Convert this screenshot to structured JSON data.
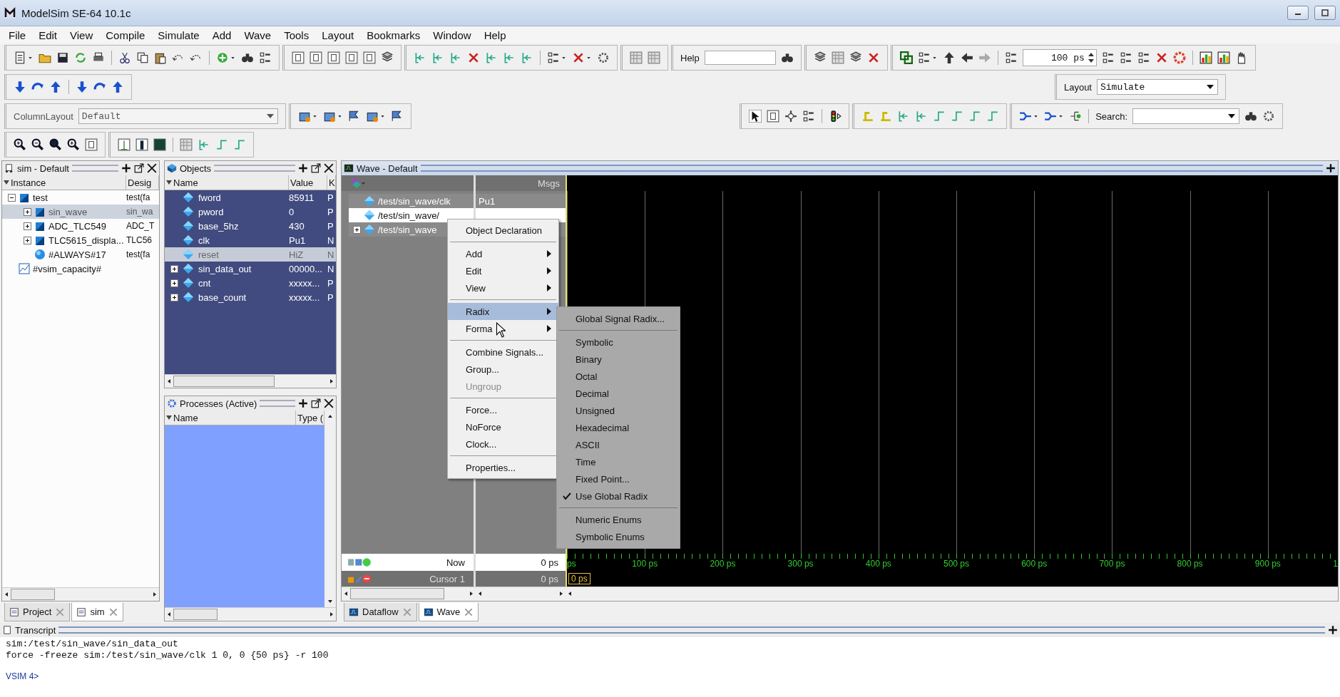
{
  "window": {
    "title": "ModelSim SE-64 10.1c"
  },
  "menu": [
    "File",
    "Edit",
    "View",
    "Compile",
    "Simulate",
    "Add",
    "Wave",
    "Tools",
    "Layout",
    "Bookmarks",
    "Window",
    "Help"
  ],
  "toolbar": {
    "help_label": "Help",
    "run_length": "100 ps",
    "layout_label": "Layout",
    "layout_value": "Simulate",
    "column_layout_label": "ColumnLayout",
    "column_layout_value": "Default",
    "search_label": "Search:"
  },
  "sim_panel": {
    "title": "sim - Default",
    "columns": [
      "Instance",
      "Desig"
    ],
    "tree": [
      {
        "kind": "instance",
        "name": "test",
        "design": "test(fa",
        "expanded": true,
        "selected": false,
        "children": [
          {
            "kind": "instance",
            "name": "sin_wave",
            "design": "sin_wa",
            "expanded": false,
            "selected": true
          },
          {
            "kind": "instance",
            "name": "ADC_TLC549",
            "design": "ADC_T",
            "expanded": false,
            "selected": false
          },
          {
            "kind": "instance",
            "name": "TLC5615_displa...",
            "design": "TLC56",
            "expanded": false,
            "selected": false
          },
          {
            "kind": "process",
            "name": "#ALWAYS#17",
            "design": "test(fa",
            "selected": false
          }
        ]
      },
      {
        "kind": "capacity",
        "name": "#vsim_capacity#",
        "selected": false
      }
    ]
  },
  "left_tabs": [
    {
      "label": "Project",
      "selected": false
    },
    {
      "label": "sim",
      "selected": true
    }
  ],
  "objects_panel": {
    "title": "Objects",
    "columns": [
      "Name",
      "Value",
      "K"
    ],
    "rows": [
      {
        "name": "fword",
        "value": "85911",
        "column_3": "P",
        "selected": false
      },
      {
        "name": "pword",
        "value": "0",
        "column_3": "P",
        "selected": false
      },
      {
        "name": "base_5hz",
        "value": "430",
        "column_3": "P",
        "selected": false
      },
      {
        "name": "clk",
        "value": "Pu1",
        "column_3": "N",
        "selected": false
      },
      {
        "name": "reset",
        "value": "HiZ",
        "column_3": "N",
        "selected": true
      },
      {
        "name": "sin_data_out",
        "value": "00000...",
        "column_3": "N",
        "expanded": false,
        "selected": false
      },
      {
        "name": "cnt",
        "value": "xxxxx...",
        "column_3": "P",
        "expanded": false,
        "selected": false
      },
      {
        "name": "base_count",
        "value": "xxxxx...",
        "column_3": "P",
        "expanded": false,
        "selected": false
      }
    ]
  },
  "processes_panel": {
    "title": "Processes (Active)",
    "columns": [
      "Name",
      "Type ("
    ]
  },
  "wave": {
    "title": "Wave - Default",
    "msgs_label": "Msgs",
    "signals": [
      {
        "path": "/test/sin_wave/clk",
        "value": "Pu1",
        "selected": false
      },
      {
        "path": "/test/sin_wave/",
        "selected": true
      },
      {
        "path": "/test/sin_wave",
        "expanded": false,
        "selected": false
      }
    ],
    "now": {
      "label": "Now",
      "value": "0 ps"
    },
    "cursor": {
      "label": "Cursor 1",
      "value": "0 ps",
      "marker": "0 ps"
    },
    "time_labels": [
      "ps",
      "100 ps",
      "200 ps",
      "300 ps",
      "400 ps",
      "500 ps",
      "600 ps",
      "700 ps",
      "800 ps",
      "900 ps",
      "1"
    ]
  },
  "context_menu": {
    "items": [
      {
        "kind": "item",
        "label": "Object Declaration",
        "disabled": false,
        "selected": false
      },
      {
        "kind": "separator"
      },
      {
        "kind": "submenu",
        "label": "Add",
        "disabled": false,
        "selected": false
      },
      {
        "kind": "submenu",
        "label": "Edit",
        "disabled": false,
        "selected": false
      },
      {
        "kind": "submenu",
        "label": "View",
        "disabled": false,
        "selected": false
      },
      {
        "kind": "separator"
      },
      {
        "kind": "submenu",
        "label": "Radix",
        "disabled": false,
        "selected": true
      },
      {
        "kind": "submenu",
        "label": "Forma",
        "disabled": false,
        "selected": false
      },
      {
        "kind": "separator"
      },
      {
        "kind": "item",
        "label": "Combine Signals...",
        "disabled": false,
        "selected": false
      },
      {
        "kind": "item",
        "label": "Group...",
        "disabled": false,
        "selected": false
      },
      {
        "kind": "item",
        "label": "Ungroup",
        "disabled": true,
        "selected": false
      },
      {
        "kind": "separator"
      },
      {
        "kind": "item",
        "label": "Force...",
        "disabled": false,
        "selected": false
      },
      {
        "kind": "item",
        "label": "NoForce",
        "disabled": false,
        "selected": false
      },
      {
        "kind": "item",
        "label": "Clock...",
        "disabled": false,
        "selected": false
      },
      {
        "kind": "separator"
      },
      {
        "kind": "item",
        "label": "Properties...",
        "disabled": false,
        "selected": false
      }
    ]
  },
  "radix_submenu": {
    "items": [
      {
        "kind": "item",
        "label": "Global Signal Radix...",
        "checked": false
      },
      {
        "kind": "separator"
      },
      {
        "kind": "item",
        "label": "Symbolic",
        "checked": false
      },
      {
        "kind": "item",
        "label": "Binary",
        "checked": false
      },
      {
        "kind": "item",
        "label": "Octal",
        "checked": false
      },
      {
        "kind": "item",
        "label": "Decimal",
        "checked": false
      },
      {
        "kind": "item",
        "label": "Unsigned",
        "checked": false
      },
      {
        "kind": "item",
        "label": "Hexadecimal",
        "checked": false
      },
      {
        "kind": "item",
        "label": "ASCII",
        "checked": false
      },
      {
        "kind": "item",
        "label": "Time",
        "checked": false
      },
      {
        "kind": "item",
        "label": "Fixed Point...",
        "checked": false
      },
      {
        "kind": "item",
        "label": "Use Global Radix",
        "checked": true
      },
      {
        "kind": "separator"
      },
      {
        "kind": "item",
        "label": "Numeric Enums",
        "checked": false
      },
      {
        "kind": "item",
        "label": "Symbolic Enums",
        "checked": false
      }
    ]
  },
  "wave_tabs": [
    {
      "label": "Dataflow",
      "selected": false
    },
    {
      "label": "Wave",
      "selected": true
    }
  ],
  "transcript": {
    "title": "Transcript",
    "lines": [
      "sim:/test/sin_wave/sin_data_out",
      "force -freeze sim:/test/sin_wave/clk 1 0, 0 {50 ps} -r 100"
    ],
    "prompt": "VSIM 4>"
  }
}
